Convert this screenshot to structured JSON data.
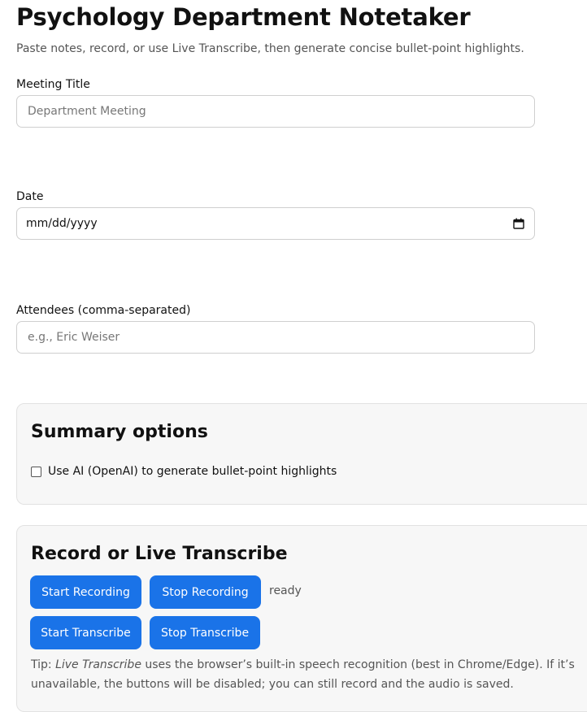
{
  "header": {
    "title": "Psychology Department Notetaker",
    "subtitle": "Paste notes, record, or use Live Transcribe, then generate concise bullet-point highlights."
  },
  "form": {
    "meeting_title": {
      "label": "Meeting Title",
      "placeholder": "Department Meeting",
      "value": ""
    },
    "date": {
      "label": "Date",
      "placeholder": "mm/dd/yyyy",
      "icon": "calendar-icon"
    },
    "attendees": {
      "label": "Attendees (comma-separated)",
      "placeholder": "e.g., Eric Weiser",
      "value": ""
    }
  },
  "summary_options": {
    "heading": "Summary options",
    "use_ai_label": "Use AI (OpenAI) to generate bullet-point highlights",
    "use_ai_checked": false
  },
  "record": {
    "heading": "Record or Live Transcribe",
    "start_recording": "Start Recording",
    "stop_recording": "Stop Recording",
    "status": "ready",
    "start_transcribe": "Start Transcribe",
    "stop_transcribe": "Stop Transcribe",
    "tip_prefix": "Tip: ",
    "tip_emphasis": "Live Transcribe",
    "tip_rest": " uses the browser’s built-in speech recognition (best in Chrome/Edge). If it’s unavailable, the buttons will be disabled; you can still record and the audio is saved."
  },
  "colors": {
    "accent": "#1a73e8",
    "panel_bg": "#f7f7f7",
    "muted_text": "#555555"
  }
}
